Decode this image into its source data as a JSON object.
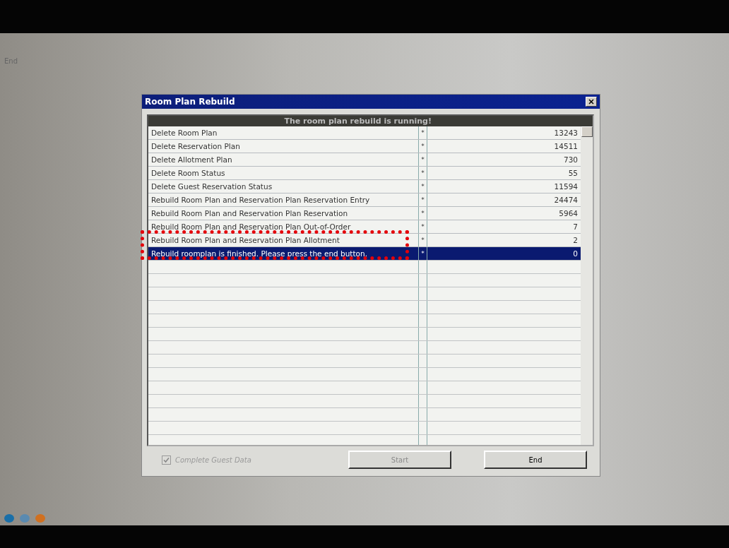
{
  "screen": {
    "corner_label": "End"
  },
  "dialog": {
    "title": "Room Plan Rebuild",
    "banner": "The room plan rebuild is running!",
    "rows": [
      {
        "label": "Delete Room Plan",
        "marker": "*",
        "count": "13243",
        "selected": false
      },
      {
        "label": "Delete Reservation Plan",
        "marker": "*",
        "count": "14511",
        "selected": false
      },
      {
        "label": "Delete Allotment Plan",
        "marker": "*",
        "count": "730",
        "selected": false
      },
      {
        "label": "Delete Room Status",
        "marker": "*",
        "count": "55",
        "selected": false
      },
      {
        "label": "Delete Guest Reservation Status",
        "marker": "*",
        "count": "11594",
        "selected": false
      },
      {
        "label": "Rebuild Room Plan and Reservation Plan Reservation Entry",
        "marker": "*",
        "count": "24474",
        "selected": false
      },
      {
        "label": "Rebuild Room Plan and Reservation Plan Reservation",
        "marker": "*",
        "count": "5964",
        "selected": false
      },
      {
        "label": "Rebuild Room Plan and Reservation Plan Out-of-Order",
        "marker": "*",
        "count": "7",
        "selected": false
      },
      {
        "label": "Rebuild Room Plan and Reservation Plan Allotment",
        "marker": "*",
        "count": "2",
        "selected": false
      },
      {
        "label": "Rebuild roomplan is finished. Please press the end button.",
        "marker": "*",
        "count": "0",
        "selected": true
      }
    ],
    "checkbox": {
      "label": "Complete Guest Data",
      "checked": true
    },
    "buttons": [
      {
        "label": "Start",
        "disabled": true
      },
      {
        "label": "End",
        "disabled": false
      }
    ]
  }
}
